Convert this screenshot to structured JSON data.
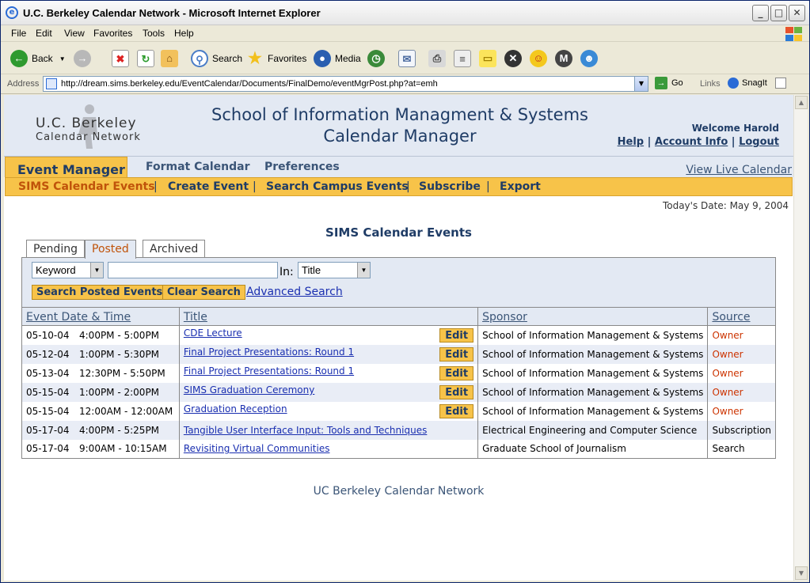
{
  "window": {
    "title": "U.C. Berkeley Calendar Network - Microsoft Internet Explorer",
    "controls": {
      "minimize": "_",
      "maximize": "□",
      "close": "✕"
    }
  },
  "menu": [
    "File",
    "Edit",
    "View",
    "Favorites",
    "Tools",
    "Help"
  ],
  "toolbar": {
    "back": "Back",
    "search": "Search",
    "favorites": "Favorites",
    "media": "Media"
  },
  "address": {
    "label": "Address",
    "url": "http://dream.sims.berkeley.edu/EventCalendar/Documents/FinalDemo/eventMgrPost.php?at=emh",
    "go": "Go",
    "links": "Links",
    "snagit": "SnagIt"
  },
  "header": {
    "logo_line1": "U.C. Berkeley",
    "logo_line2": "Calendar Network",
    "title_line1": "School of Information Managment & Systems",
    "title_line2": "Calendar Manager",
    "welcome": "Welcome Harold",
    "links": [
      "Help",
      "Account Info",
      "Logout"
    ]
  },
  "nav": {
    "active": "Event Manager",
    "tabs": [
      "Format Calendar",
      "Preferences"
    ],
    "live": "View Live Calendar",
    "sub": [
      "SIMS Calendar Events",
      "Create Event",
      "Search Campus Events",
      "Subscribe",
      "Export"
    ]
  },
  "today": "Today's Date: May 9, 2004",
  "page_title": "SIMS Calendar Events",
  "subtabs": [
    "Pending",
    "Posted",
    "Archived"
  ],
  "search": {
    "field": "Keyword",
    "in_label": "In:",
    "in_value": "Title",
    "search_btn": "Search Posted Events",
    "clear_btn": "Clear Search",
    "advanced": "Advanced Search"
  },
  "table": {
    "headers": [
      "Event Date & Time",
      "Title",
      "Sponsor",
      "Source"
    ],
    "edit_label": "Edit",
    "rows": [
      {
        "date": "05-10-04",
        "time": "4:00PM - 5:00PM",
        "title": "CDE Lecture",
        "sponsor": "School of Information Management & Systems",
        "source": "Owner",
        "edit": true
      },
      {
        "date": "05-12-04",
        "time": "1:00PM - 5:30PM",
        "title": "Final Project Presentations: Round 1",
        "sponsor": "School of Information Management & Systems",
        "source": "Owner",
        "edit": true
      },
      {
        "date": "05-13-04",
        "time": "12:30PM - 5:50PM",
        "title": "Final Project Presentations: Round 1",
        "sponsor": "School of Information Management & Systems",
        "source": "Owner",
        "edit": true
      },
      {
        "date": "05-15-04",
        "time": "1:00PM - 2:00PM",
        "title": "SIMS Graduation Ceremony",
        "sponsor": "School of Information Management & Systems",
        "source": "Owner",
        "edit": true
      },
      {
        "date": "05-15-04",
        "time": "12:00AM - 12:00AM",
        "title": "Graduation Reception",
        "sponsor": "School of Information Management & Systems",
        "source": "Owner",
        "edit": true
      },
      {
        "date": "05-17-04",
        "time": "4:00PM - 5:25PM",
        "title": "Tangible User Interface Input: Tools and Techniques",
        "sponsor": "Electrical Engineering and Computer Science",
        "source": "Subscription",
        "edit": false
      },
      {
        "date": "05-17-04",
        "time": "9:00AM - 10:15AM",
        "title": "Revisiting Virtual Communities",
        "sponsor": "Graduate School of Journalism",
        "source": "Search",
        "edit": false
      }
    ]
  },
  "footer": "UC Berkeley Calendar Network"
}
